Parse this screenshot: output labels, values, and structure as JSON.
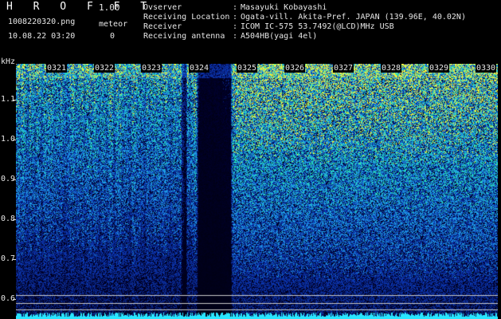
{
  "header": {
    "app_title": "H R O F F T",
    "version": "1.00",
    "filename": "1008220320.png",
    "datetime": "10.08.22 03:20",
    "meteor_label": "meteor",
    "meteor_count": "0"
  },
  "info": [
    {
      "label": "Ovserver",
      "sep": ":",
      "value": "Masayuki Kobayashi"
    },
    {
      "label": "Receiving Location",
      "sep": ":",
      "value": "Ogata-vill. Akita-Pref. JAPAN (139.96E, 40.02N)"
    },
    {
      "label": "Receiver",
      "sep": ":",
      "value": "ICOM IC-575 53.7492(@LCD)MHz USB"
    },
    {
      "label": "Receiving antenna",
      "sep": ":",
      "value": "A504HB(yagi 4el)"
    }
  ],
  "axis": {
    "unit": "kHz",
    "y_ticks": [
      "1.1",
      "1.0",
      "0.9",
      "0.8",
      "0.7",
      "0.6"
    ],
    "time_labels": [
      "0321",
      "0322",
      "0323",
      "0324",
      "0325",
      "0326",
      "0327",
      "0328",
      "0329",
      "0330"
    ]
  },
  "colors": {
    "background": "#000000",
    "low": "#041050",
    "mid": "#1f4fd0",
    "high": "#33d0a0",
    "peak": "#e0f040",
    "reference_line": "#c8c8c8"
  }
}
